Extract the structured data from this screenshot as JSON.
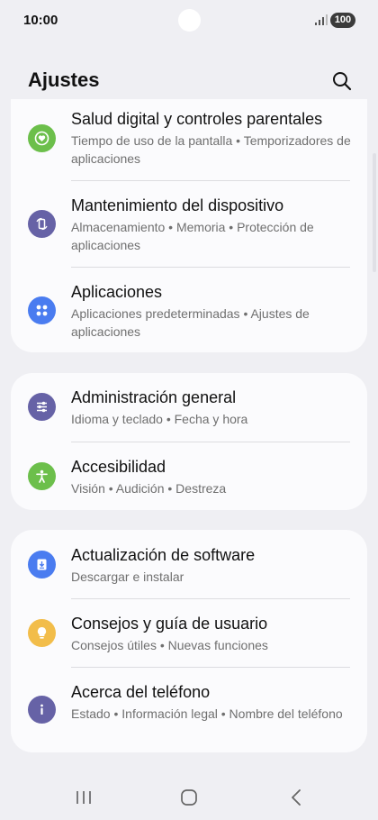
{
  "status": {
    "time": "10:00",
    "battery": "100"
  },
  "header": {
    "title": "Ajustes"
  },
  "groups": [
    {
      "items": [
        {
          "title": "Salud digital y controles parentales",
          "subtitle": "Tiempo de uso de la pantalla  •  Temporizadores de aplicaciones",
          "icon": "heart-in-circle-icon",
          "color": "#6cbf4b"
        },
        {
          "title": "Mantenimiento del dispositivo",
          "subtitle": "Almacenamiento  •  Memoria  •  Protección de aplicaciones",
          "icon": "refresh-cycle-icon",
          "color": "#6662a6"
        },
        {
          "title": "Aplicaciones",
          "subtitle": "Aplicaciones predeterminadas  •  Ajustes de aplicaciones",
          "icon": "apps-grid-icon",
          "color": "#4a7cf0"
        }
      ]
    },
    {
      "items": [
        {
          "title": "Administración general",
          "subtitle": "Idioma y teclado  •  Fecha y hora",
          "icon": "sliders-icon",
          "color": "#6662a6"
        },
        {
          "title": "Accesibilidad",
          "subtitle": "Visión  •  Audición  •  Destreza",
          "icon": "accessibility-person-icon",
          "color": "#6cbf4b"
        }
      ]
    },
    {
      "items": [
        {
          "title": "Actualización de software",
          "subtitle": "Descargar e instalar",
          "icon": "download-update-icon",
          "color": "#4a7cf0"
        },
        {
          "title": "Consejos y guía de usuario",
          "subtitle": "Consejos útiles  •  Nuevas funciones",
          "icon": "lightbulb-icon",
          "color": "#f2bd4a"
        },
        {
          "title": "Acerca del teléfono",
          "subtitle": "Estado  •  Información legal  •  Nombre del teléfono",
          "icon": "info-icon",
          "color": "#6662a6"
        }
      ]
    }
  ],
  "nav": {
    "recents": "recents-icon",
    "home": "home-icon",
    "back": "back-icon"
  }
}
